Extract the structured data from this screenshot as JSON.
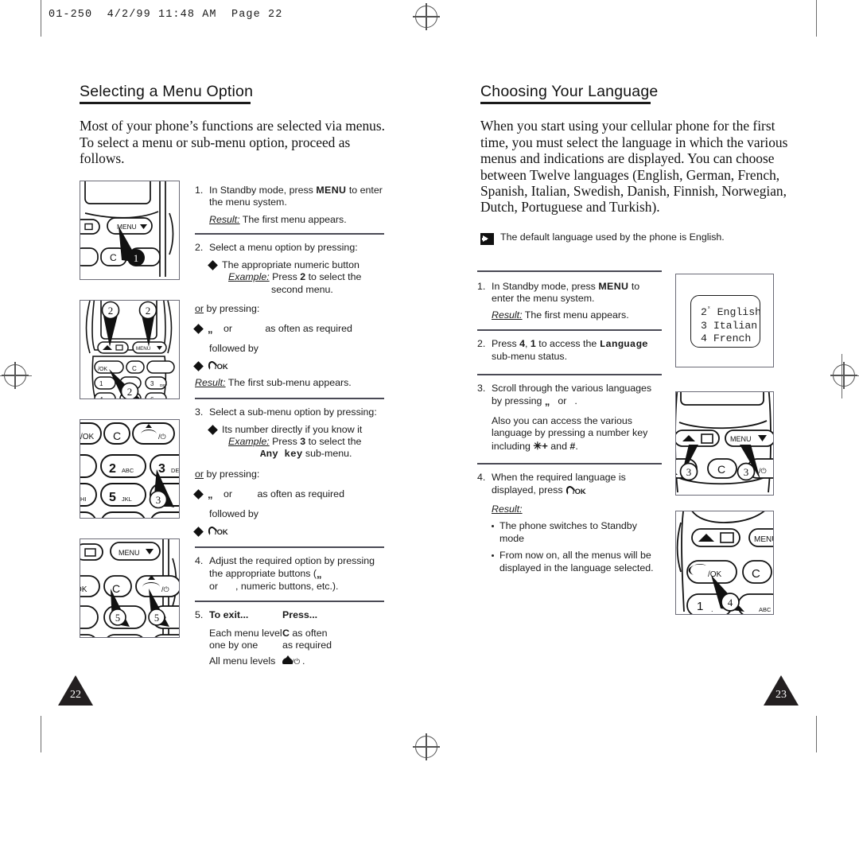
{
  "page": {
    "header_text": "01-250  4/2/99 11:48 AM  Page 22",
    "page_left": "22",
    "page_right": "23"
  },
  "left": {
    "title": "Selecting a Menu Option",
    "intro": "Most of your phone’s functions are selected via menus. To select a menu or sub-menu option, proceed as follows.",
    "steps": {
      "s1_num": "1.",
      "s1_text": "In Standby mode, press ",
      "s1_key": "MENU",
      "s1_text2": " to enter the menu system.",
      "s1_result_label": "Result:",
      "s1_result": " The first menu appears.",
      "s2_num": "2.",
      "s2_text": "Select a menu option by pressing:",
      "s2_b1": "The appropriate numeric button",
      "s2_b1_ex_label": "Example:",
      "s2_b1_ex": " Press ",
      "s2_b1_key": "2",
      "s2_b1_ex2": " to select the",
      "s2_b1_ex3": "second menu.",
      "s2_or": "or",
      "s2_or_text": " by pressing:",
      "s2_b2_mid": "or",
      "s2_b2_end": "as often as required",
      "s2_followed": "followed by",
      "s2_result_label": "Result:",
      "s2_result": " The first sub-menu appears.",
      "s3_num": "3.",
      "s3_text": "Select a sub-menu option by pressing:",
      "s3_b1": "Its number directly if you know it",
      "s3_b1_ex_label": "Example:",
      "s3_b1_ex": " Press ",
      "s3_b1_key": "3",
      "s3_b1_ex2": " to select the",
      "s3_b1_sub": "Any key",
      "s3_b1_sub2": " sub-menu.",
      "s3_or": "or",
      "s3_or_text": " by pressing:",
      "s3_b2_mid": "or",
      "s3_b2_end": "as often as required",
      "s3_followed": "followed by",
      "s4_num": "4.",
      "s4_text": "Adjust the required option by pressing the appropriate buttons (",
      "s4_text2": "or",
      "s4_text3": ", numeric buttons, etc.).",
      "s5_num": "5.",
      "s5_h1": "To exit...",
      "s5_h2": "Press...",
      "s5_r1c1a": "Each menu level",
      "s5_r1c1b": "one by one",
      "s5_r1c2_key": "C",
      "s5_r1c2a": " as often",
      "s5_r1c2b": "as required",
      "s5_r2c1": "All menu levels",
      "s5_r2c2_suffix": "."
    },
    "figures": [
      {
        "name": "phone-menu-key-figure",
        "callout": "1"
      },
      {
        "name": "phone-scroll-keys-figure",
        "callout": "2"
      },
      {
        "name": "phone-numeric-keys-figure",
        "callout": "3"
      },
      {
        "name": "phone-exit-keys-figure",
        "callout": "5"
      }
    ]
  },
  "right": {
    "title": "Choosing Your Language",
    "intro": "When you start using your cellular phone for the first time, you must select the language in which the various menus and indications are displayed. You can choose between Twelve languages (English, German, French, Spanish, Italian, Swedish, Danish, Finnish, Norwegian, Dutch, Portuguese and Turkish).",
    "note": "The default language used by the phone is English.",
    "steps": {
      "s1_num": "1.",
      "s1_text": "In Standby mode, press ",
      "s1_key": "MENU",
      "s1_text2": " to enter the menu system.",
      "s1_result_label": "Result:",
      "s1_result": " The first menu appears.",
      "s2_num": "2.",
      "s2_text": "Press ",
      "s2_k1": "4",
      "s2_text_c": ", ",
      "s2_k2": "1",
      "s2_text2": " to access the ",
      "s2_mono": "Language",
      "s2_text3": "sub-menu status.",
      "s3_num": "3.",
      "s3_text": "Scroll through the various languages by pressing ",
      "s3_or": "or",
      "s3_p2": "Also you can access the various language by pressing a number key including ",
      "s3_star": "✳+",
      "s3_p2b": " and ",
      "s3_hash": "#",
      "s3_p2c": ".",
      "s4_num": "4.",
      "s4_text": "When the required language is displayed, press ",
      "s4_dot": ".",
      "s4_result_label": "Result:",
      "s4_b1": "The phone switches to Standby mode",
      "s4_b2": "From now on, all the menus will be displayed in the language selected."
    },
    "lcd": {
      "line1_num": "2",
      "line1_sup": "ˣ",
      "line1_label": " English",
      "line2": "3 Italian",
      "line3": "4 French"
    },
    "figures": [
      {
        "name": "phone-scroll-language-figure",
        "callout": "3"
      },
      {
        "name": "phone-confirm-key-figure",
        "callout": "4"
      }
    ]
  }
}
